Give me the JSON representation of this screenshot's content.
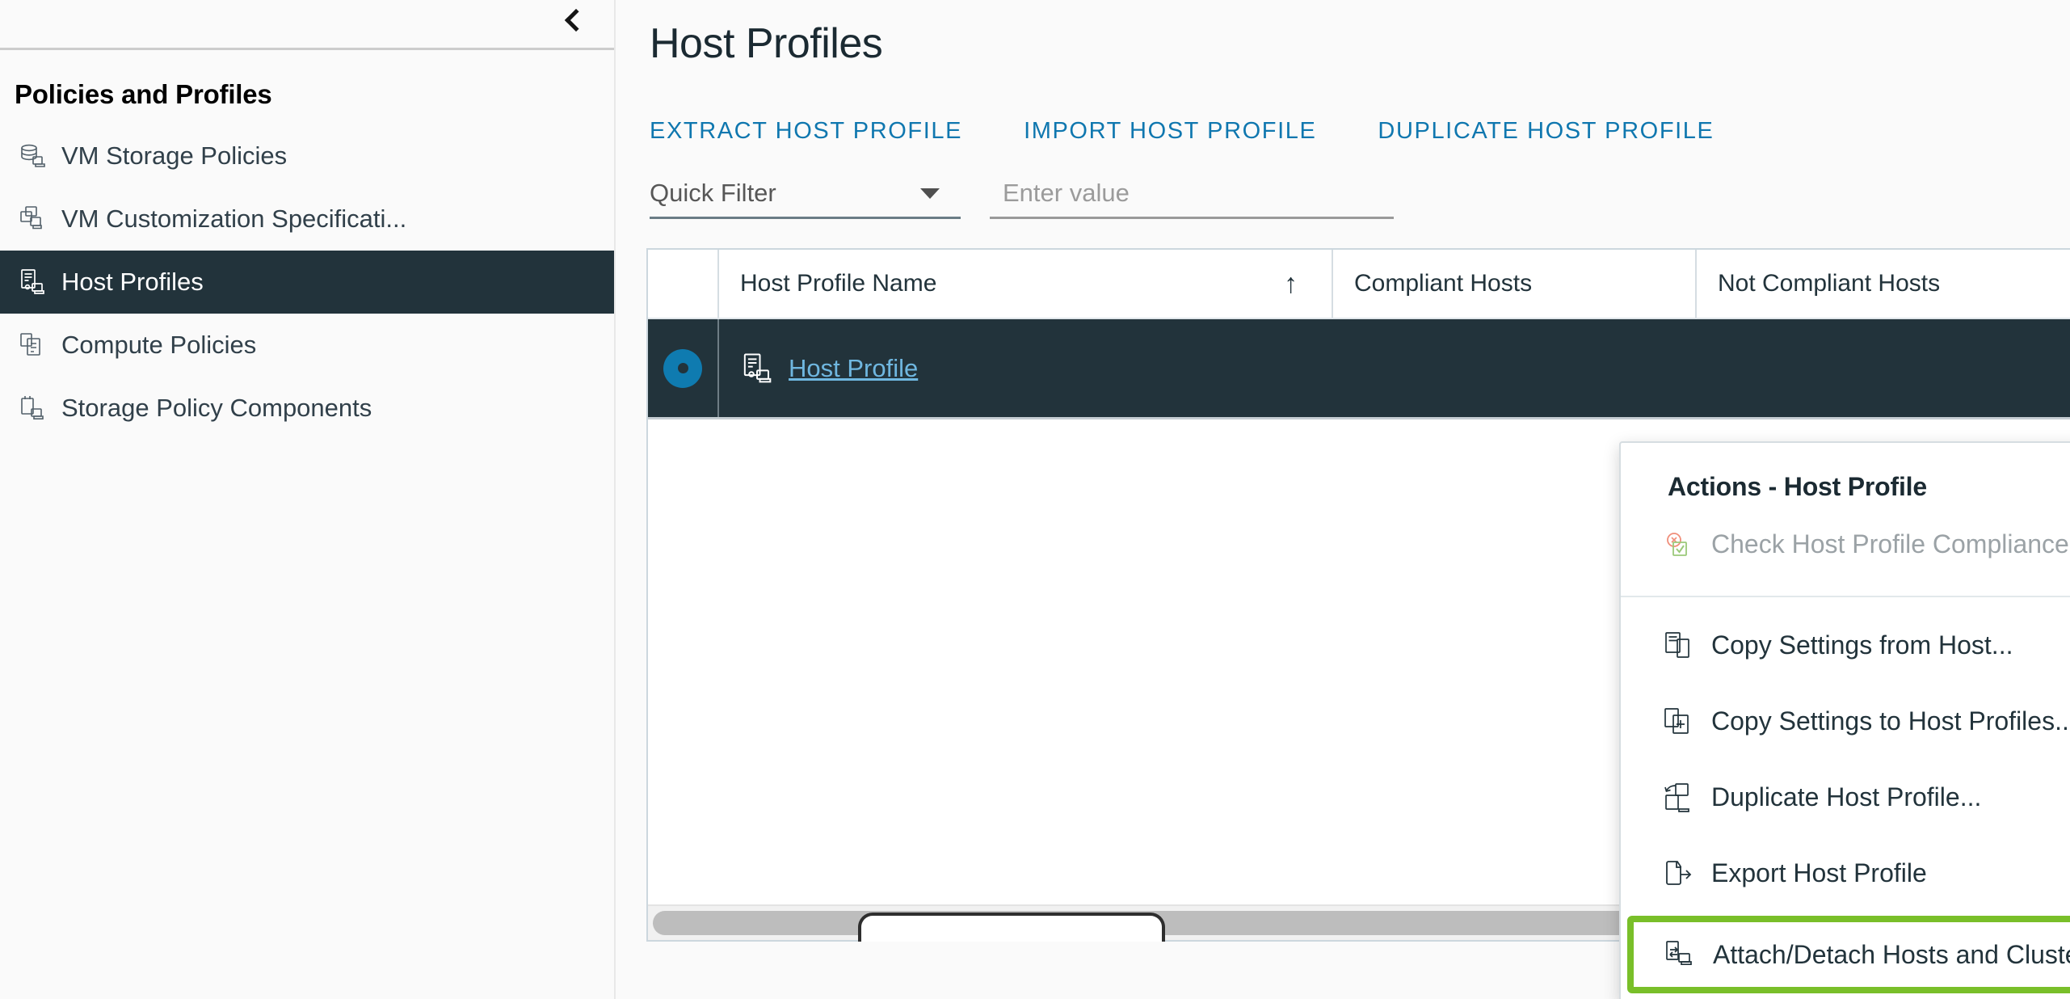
{
  "sidebar": {
    "collapse_icon": "chevron-left-icon",
    "title": "Policies and Profiles",
    "items": [
      {
        "label": "VM Storage Policies",
        "icon": "vm-storage-policy-icon",
        "selected": false
      },
      {
        "label": "VM Customization Specificati...",
        "icon": "vm-customization-icon",
        "selected": false
      },
      {
        "label": "Host Profiles",
        "icon": "host-profile-icon",
        "selected": true
      },
      {
        "label": "Compute Policies",
        "icon": "compute-policy-icon",
        "selected": false
      },
      {
        "label": "Storage Policy Components",
        "icon": "storage-policy-component-icon",
        "selected": false
      }
    ]
  },
  "main": {
    "page_title": "Host Profiles",
    "actions": [
      {
        "label": "EXTRACT HOST PROFILE"
      },
      {
        "label": "IMPORT HOST PROFILE"
      },
      {
        "label": "DUPLICATE HOST PROFILE"
      }
    ],
    "filter": {
      "select_label": "Quick Filter",
      "select_icon": "chevron-down-icon",
      "input_value": "",
      "input_placeholder": "Enter value"
    },
    "table": {
      "columns": [
        {
          "label": "Host Profile Name",
          "sort_icon": "sort-ascending-arrow"
        },
        {
          "label": "Compliant Hosts"
        },
        {
          "label": "Not Compliant Hosts"
        }
      ],
      "rows": [
        {
          "selected": true,
          "radio_icon": "radio-selected-icon",
          "name_icon": "host-profile-icon",
          "name": "Host Profile"
        }
      ]
    }
  },
  "context_menu": {
    "header": "Actions - Host Profile",
    "disabled_item": {
      "label": "Check Host Profile Compliance",
      "icon": "compliance-check-icon"
    },
    "items": [
      {
        "label": "Copy Settings from Host...",
        "icon": "copy-from-host-icon",
        "highlighted": false
      },
      {
        "label": "Copy Settings to Host Profiles...",
        "icon": "copy-to-profiles-icon",
        "highlighted": false
      },
      {
        "label": "Duplicate Host Profile...",
        "icon": "duplicate-profile-icon",
        "highlighted": false
      },
      {
        "label": "Export Host Profile",
        "icon": "export-profile-icon",
        "highlighted": false
      },
      {
        "label": "Attach/Detach Hosts and Clusters...",
        "icon": "attach-detach-icon",
        "highlighted": true
      }
    ]
  },
  "colors": {
    "accent_link": "#0f77af",
    "selected_row_bg": "#22333b",
    "highlight_border": "#79bf29",
    "radio_fill": "#0f7bb0",
    "row_link": "#6fb7e0"
  }
}
